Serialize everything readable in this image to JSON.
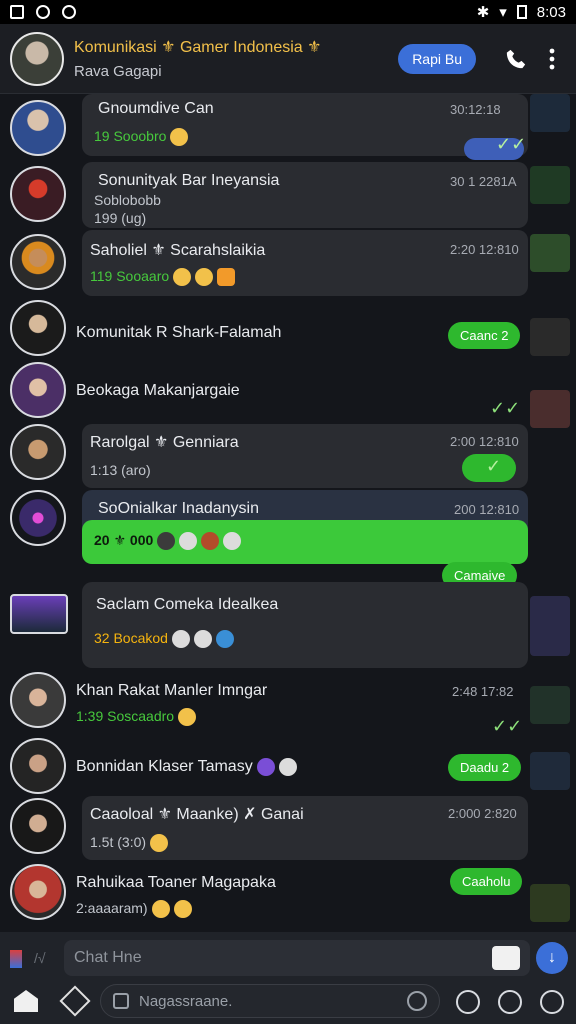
{
  "statusbar": {
    "time": "8:03"
  },
  "header": {
    "title": "Komunikasi ⚜ Gamer Indonesia ⚜",
    "subtitle": "Rava Gagapi",
    "action_label": "Rapi Bu"
  },
  "chats": [
    {
      "name": "Gnoumdive Can",
      "time": "30:12:18",
      "preview_hl": "19 Sooobro",
      "emoji": [
        "#f2c14a"
      ],
      "pill": "",
      "check": "✓✓",
      "blue": true
    },
    {
      "name": "Sonunityak Bar Ineyansia",
      "time": "30 1 2281A",
      "preview_hl": "Soblobobb",
      "line3": "199 (ug)",
      "emoji": [],
      "pill": "",
      "check": ""
    },
    {
      "name": "Saholiel ⚜ Scarahslaikia",
      "time": "2:20 12:810",
      "preview_hl": "119 Sooaaro",
      "emoji": [
        "#f2c14a",
        "#f2c14a",
        "#f29a2a"
      ],
      "pill": "",
      "check": ""
    },
    {
      "name": "Komunitak R Shark-Falamah",
      "time": "",
      "preview_hl": "",
      "emoji": [],
      "pill": "Caanc 2",
      "check": "✓"
    },
    {
      "name": "Beokaga Makanjargaie",
      "time": "",
      "preview_hl": "",
      "emoji": [],
      "pill": "",
      "check": "✓✓"
    },
    {
      "name": "Rarolgal ⚜ Genniara",
      "time": "2:00 12:810",
      "preview_hl": "1:13 (aro)",
      "emoji": [],
      "pill": "",
      "check": "✓"
    },
    {
      "name": "SoOnialkar Inadanysin",
      "time": "200 12:810",
      "preview_hl": "20 ⚜ 000",
      "emoji": [
        "#3b3b3b",
        "#dcdcdc",
        "#b34b2a",
        "#dcdcdc"
      ],
      "pill": "Camaive",
      "check": ""
    },
    {
      "name": "Saclam Comeka Idealkea",
      "time": "",
      "preview_hl": "32 Bocakod",
      "emoji": [
        "#dcdcdc",
        "#dcdcdc",
        "#3a8fd6"
      ],
      "pill": "",
      "check": ""
    },
    {
      "name": "Khan Rakat Manler Imngar",
      "time": "2:48 17:82",
      "preview_hl": "1:39 Soscaadro",
      "emoji": [
        "#f2c14a"
      ],
      "pill": "",
      "check": "✓✓"
    },
    {
      "name": "Bonnidan Klaser Tamasy",
      "time": "",
      "preview_hl": "",
      "emoji": [
        "#7a4ed6",
        "#dcdcdc"
      ],
      "pill": "Daadu 2",
      "check": "✓"
    },
    {
      "name": "Caaoloal ⚜ Maanke) ✗ Ganai",
      "time": "2:000 2:820",
      "preview_hl": "1.5t (3:0)",
      "emoji": [
        "#f2c14a"
      ],
      "pill": "",
      "check": ""
    },
    {
      "name": "Rahuikaa Toaner Magapaka",
      "time": "",
      "preview_hl": "2:aaaaram)",
      "emoji": [
        "#f2c14a",
        "#f2c14a"
      ],
      "pill": "Caaholu",
      "check": ""
    }
  ],
  "composer": {
    "placeholder": "Chat Hne",
    "search_placeholder": "Nagassraane."
  }
}
